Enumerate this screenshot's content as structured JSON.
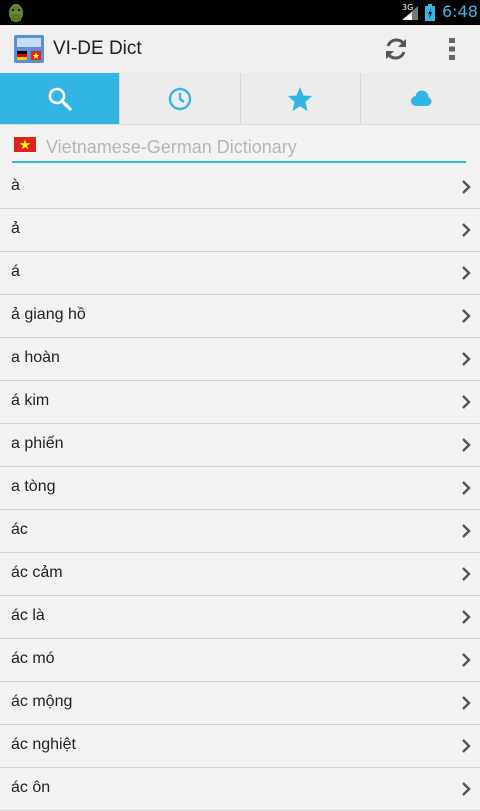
{
  "status_bar": {
    "network": "3G",
    "time": "6:48"
  },
  "app": {
    "title": "VI-DE Dict"
  },
  "tabs": [
    {
      "name": "search",
      "icon": "search-icon",
      "active": true
    },
    {
      "name": "history",
      "icon": "clock-icon",
      "active": false
    },
    {
      "name": "favorites",
      "icon": "star-icon",
      "active": false
    },
    {
      "name": "cloud",
      "icon": "cloud-icon",
      "active": false
    }
  ],
  "search": {
    "placeholder": "Vietnamese-German Dictionary",
    "value": ""
  },
  "entries": [
    "à",
    "ả",
    "á",
    "ả giang hồ",
    "a hoàn",
    "á kim",
    "a phiến",
    "a tòng",
    "ác",
    "ác cảm",
    "ác là",
    "ác mó",
    "ác mộng",
    "ác nghiệt",
    "ác ôn"
  ],
  "colors": {
    "accent": "#33b5e5",
    "background": "#f3f3f3"
  }
}
